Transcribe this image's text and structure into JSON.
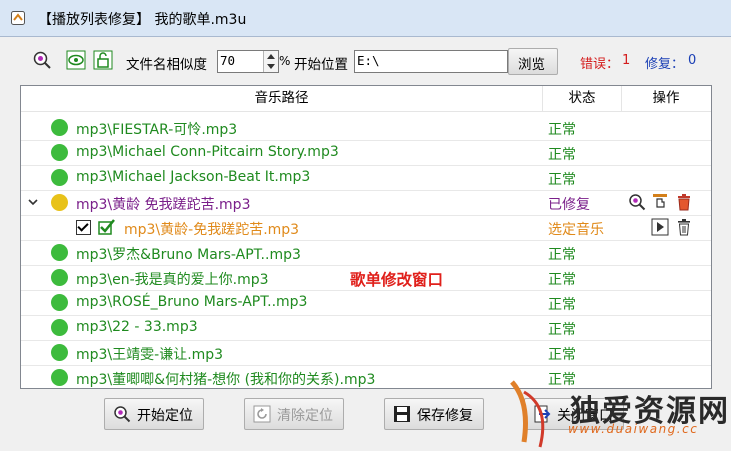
{
  "window": {
    "title": "【播放列表修复】 我的歌单.m3u"
  },
  "toolbar": {
    "similarity_label": "文件名相似度",
    "similarity_value": "70",
    "percent_sign": "%",
    "start_label": "开始位置",
    "start_value": "E:\\",
    "browse_label": "浏览",
    "error_label": "错误：",
    "error_count": "1",
    "fix_label": "修复：",
    "fix_count": "0"
  },
  "list": {
    "columns": [
      "音乐路径",
      "状态",
      "操作"
    ],
    "rows": [
      {
        "path": "mp3\\FIESTAR-可怜.mp3",
        "status": "正常"
      },
      {
        "path": "mp3\\Michael Conn-Pitcairn Story.mp3",
        "status": "正常"
      },
      {
        "path": "mp3\\Michael Jackson-Beat It.mp3",
        "status": "正常"
      },
      {
        "path": "mp3\\黄龄 免我蹉跎苦.mp3",
        "status": "已修复"
      },
      {
        "path": "mp3\\黄龄-免我蹉跎苦.mp3",
        "status": "选定音乐"
      },
      {
        "path": "mp3\\罗杰&Bruno Mars-APT..mp3",
        "status": "正常"
      },
      {
        "path": "mp3\\en-我是真的爱上你.mp3",
        "status": "正常"
      },
      {
        "path": "mp3\\ROSÉ_Bruno Mars-APT..mp3",
        "status": "正常"
      },
      {
        "path": "mp3\\22 - 33.mp3",
        "status": "正常"
      },
      {
        "path": "mp3\\王靖雯-谦让.mp3",
        "status": "正常"
      },
      {
        "path": "mp3\\董唧唧&何村猪-想你 (我和你的关系).mp3",
        "status": "正常"
      }
    ]
  },
  "overlay_label": "歌单修改窗口",
  "buttons": {
    "start_locate": "开始定位",
    "clear_locate": "清除定位",
    "save_fix": "保存修复",
    "close_window": "关闭窗口"
  },
  "watermark": {
    "big": "独爱资源网",
    "small": "www.duaiwang.cc"
  },
  "colors": {
    "green_text": "#1f8a1f",
    "purple_text": "#7a1f8a",
    "orange_text": "#e08a1a",
    "red_text": "#d41c1c",
    "blue_text": "#1a3fb5"
  }
}
